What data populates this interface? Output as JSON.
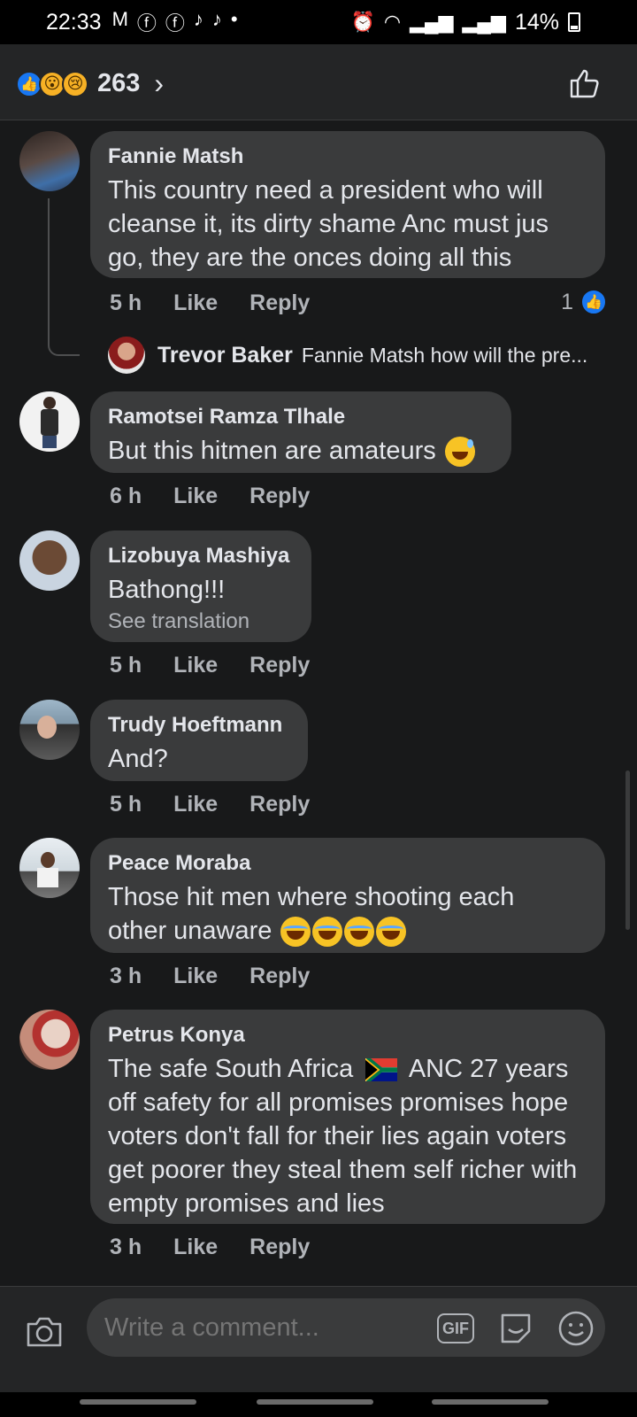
{
  "status_bar": {
    "time": "22:33",
    "notification_icons": [
      "gmail-icon",
      "facebook-icon",
      "facebook-icon",
      "tiktok-icon",
      "tiktok-icon",
      "dot-icon"
    ],
    "battery": "14%"
  },
  "header": {
    "reaction_count": "263",
    "reactions": [
      "like",
      "wow",
      "sad"
    ]
  },
  "comments": [
    {
      "author": "Fannie Matsh",
      "text": "This country need a president who will cleanse it, its dirty shame Anc must jus go, they are the onces doing all this",
      "time": "5 h",
      "like_label": "Like",
      "reply_label": "Reply",
      "like_count": "1",
      "reply": {
        "author": "Trevor Baker",
        "text": "Fannie Matsh how will the pre..."
      }
    },
    {
      "author": "Ramotsei Ramza Tlhale",
      "text": "But this hitmen are amateurs",
      "time": "6 h",
      "like_label": "Like",
      "reply_label": "Reply"
    },
    {
      "author": "Lizobuya Mashiya",
      "text": "Bathong!!!",
      "translate": "See translation",
      "time": "5 h",
      "like_label": "Like",
      "reply_label": "Reply"
    },
    {
      "author": "Trudy Hoeftmann",
      "text": "And?",
      "time": "5 h",
      "like_label": "Like",
      "reply_label": "Reply"
    },
    {
      "author": "Peace Moraba",
      "text_line1": "Those hit men where shooting each",
      "text_line2": "other unaware",
      "time": "3 h",
      "like_label": "Like",
      "reply_label": "Reply"
    },
    {
      "author": "Petrus Konya",
      "text_line1a": "The safe South Africa",
      "text_line1b": "ANC 27 years",
      "text_rest": "off safety  for all promises promises hope voters don't fall for their lies again voters get poorer  they  steal them self richer  with empty promises and lies",
      "time": "3 h",
      "like_label": "Like",
      "reply_label": "Reply"
    }
  ],
  "composer": {
    "placeholder": "Write a comment...",
    "gif_label": "GIF"
  },
  "colors": {
    "background": "#18191a",
    "bubble": "#3a3b3c",
    "accent": "#1877f2",
    "secondary_text": "#b0b3b8"
  }
}
